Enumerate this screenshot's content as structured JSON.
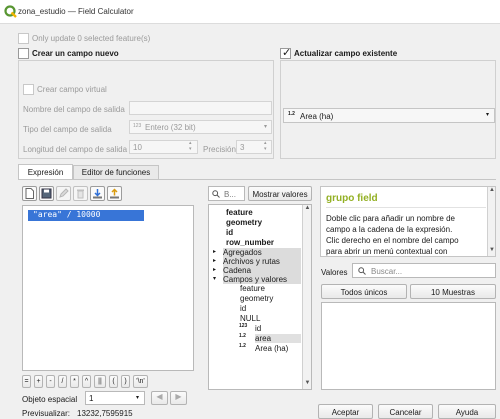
{
  "window": {
    "title": "zona_estudio — Field Calculator"
  },
  "top": {
    "only_update_label": "Only update 0 selected feature(s)",
    "create_field_label": "Crear un campo nuevo",
    "update_field_label": "Actualizar campo existente"
  },
  "create": {
    "virtual_label": "Crear campo virtual",
    "name_label": "Nombre del campo de salida",
    "name_value": "",
    "type_label": "Tipo del campo de salida",
    "type_prefix": "123",
    "type_value": "Entero (32 bit)",
    "length_label": "Longitud del campo de salida",
    "length_value": "10",
    "precision_label": "Precisión",
    "precision_value": "3"
  },
  "update": {
    "field_prefix": "1.2",
    "field_value": "Area (ha)"
  },
  "tabs": {
    "expression": "Expresión",
    "functions": "Editor de funciones"
  },
  "expression": {
    "text": "\"area\" / 10000"
  },
  "operators": [
    "=",
    "+",
    "-",
    "/",
    "*",
    "^",
    "||",
    "(",
    ")",
    "'\\n'"
  ],
  "geom": {
    "label": "Objeto espacial",
    "value": "1"
  },
  "preview": {
    "label": "Previsualizar:",
    "value": "13232,7595915"
  },
  "search": {
    "placeholder": "B...",
    "show_values_label": "Mostrar valores"
  },
  "tree": {
    "top_items": [
      "feature",
      "geometry",
      "id",
      "row_number"
    ],
    "groups": [
      "Agregados",
      "Archivos y rutas",
      "Cadena",
      "Campos y valores"
    ],
    "children": [
      "feature",
      "geometry",
      "id",
      "NULL",
      "id",
      "area",
      "Area (ha)"
    ],
    "child_prefixes": [
      "",
      "",
      "",
      "",
      "123",
      "1.2",
      "1.2"
    ]
  },
  "help": {
    "title": "grupo field",
    "body_lines": [
      "Doble clic para añadir un nombre de",
      "campo a la cadena de la expresión.",
      "Clic derecho en el nombre del campo",
      "para abrir un menú contextual con"
    ]
  },
  "values": {
    "label": "Valores",
    "search_placeholder": "Buscar...",
    "all_unique_label": "Todos únicos",
    "sample_label": "10 Muestras"
  },
  "buttons": {
    "ok": "Aceptar",
    "cancel": "Cancelar",
    "help": "Ayuda"
  },
  "colors": {
    "help_title": "#93b023",
    "selection": "#3875d7",
    "qgis_green": "#589632"
  }
}
